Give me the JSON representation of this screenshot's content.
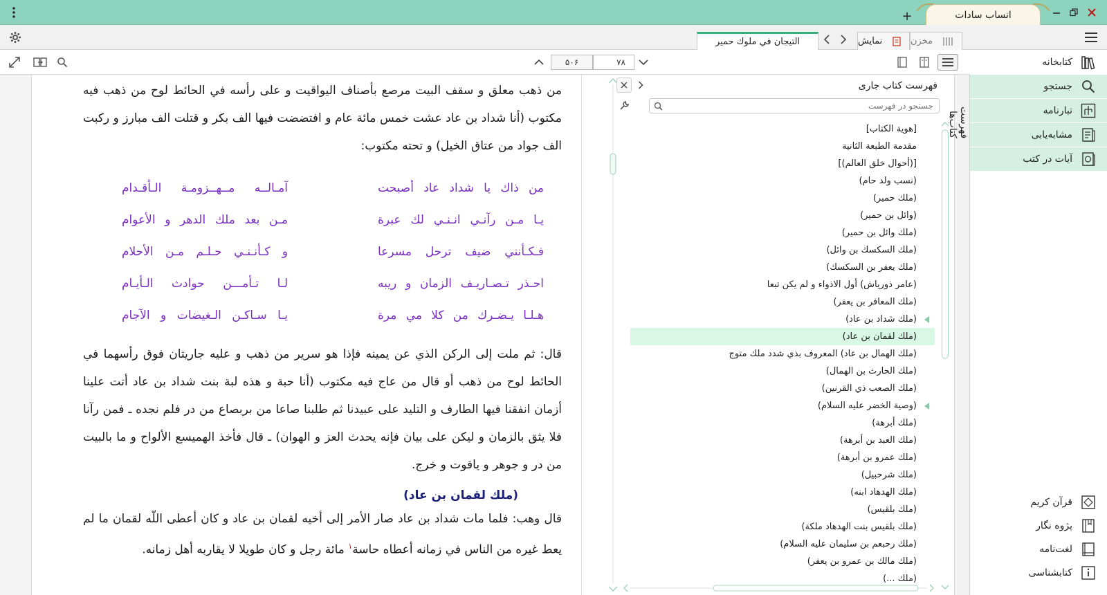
{
  "window": {
    "app_tab_label": "انساب سادات",
    "add_tab_label": "+"
  },
  "tabs": {
    "repository_label": "مخزن",
    "display_label": "نمایش",
    "book_tab_label": "التيجان في ملوك حمير"
  },
  "pager": {
    "current_page": "۷۸",
    "total_pages": "۵۰۶"
  },
  "toc": {
    "title": "فهرست کتاب جاری",
    "search_placeholder": "جستجو در فهرست",
    "items": [
      {
        "label": "[هوية الكتاب]",
        "expandable": false,
        "selected": false
      },
      {
        "label": "مقدمة الطبعة الثانية",
        "expandable": false,
        "selected": false
      },
      {
        "label": "[(أحوال خلق العالم)]",
        "expandable": false,
        "selected": false
      },
      {
        "label": "(نسب ولد حام)",
        "expandable": false,
        "selected": false
      },
      {
        "label": "(ملك حمير)",
        "expandable": false,
        "selected": false
      },
      {
        "label": "(وائل بن حمير)",
        "expandable": false,
        "selected": false
      },
      {
        "label": "(ملك وائل بن حمير)",
        "expandable": false,
        "selected": false
      },
      {
        "label": "(ملك السكسك بن وائل)",
        "expandable": false,
        "selected": false
      },
      {
        "label": "(ملك يعفر بن السكسك)",
        "expandable": false,
        "selected": false
      },
      {
        "label": "(عامر ذورياش) أول الاذواء و لم يكن تبعا",
        "expandable": false,
        "selected": false
      },
      {
        "label": "(ملك المعافر بن يعفر)",
        "expandable": false,
        "selected": false
      },
      {
        "label": "(ملك شداد بن عاد)",
        "expandable": true,
        "selected": false
      },
      {
        "label": "(ملك لقمان بن عاد)",
        "expandable": false,
        "selected": true
      },
      {
        "label": "(ملك الهمال بن عاد) المعروف بذي شدد ملك متوج",
        "expandable": false,
        "selected": false
      },
      {
        "label": "(ملك الحارث بن الهمال)",
        "expandable": false,
        "selected": false
      },
      {
        "label": "(ملك الصعب ذي القرنين)",
        "expandable": false,
        "selected": false
      },
      {
        "label": "(وصية الخضر عليه السلام)",
        "expandable": true,
        "selected": false
      },
      {
        "label": "(ملك أبرهة)",
        "expandable": false,
        "selected": false
      },
      {
        "label": "(ملك العبد بن أبرهة)",
        "expandable": false,
        "selected": false
      },
      {
        "label": "(ملك عمرو بن أبرهة)",
        "expandable": false,
        "selected": false
      },
      {
        "label": "(ملك شرحبيل)",
        "expandable": false,
        "selected": false
      },
      {
        "label": "(ملك الهدهاد ابنه)",
        "expandable": false,
        "selected": false
      },
      {
        "label": "(ملك بلقيس)",
        "expandable": false,
        "selected": false
      },
      {
        "label": "(ملك بلقيس بنت الهدهاد ملكة)",
        "expandable": false,
        "selected": false
      },
      {
        "label": "(ملك رحبعم بن سليمان عليه السلام)",
        "expandable": false,
        "selected": false
      },
      {
        "label": "(ملك مالك بن عمرو بن يعفر)",
        "expandable": false,
        "selected": false
      },
      {
        "label": "(ملك ...)",
        "expandable": false,
        "selected": false
      }
    ]
  },
  "side_tab_label": "فهرست کتاب‌ها",
  "sidebar": {
    "items": [
      {
        "label": "کتابخانه",
        "icon": "books-icon"
      },
      {
        "label": "جستجو",
        "icon": "search-icon"
      },
      {
        "label": "تبارنامه",
        "icon": "family-tree-icon"
      },
      {
        "label": "مشابه‌یابی",
        "icon": "similar-icon"
      },
      {
        "label": "آیات در کتب",
        "icon": "verses-icon"
      }
    ],
    "bottom_items": [
      {
        "label": "قرآن کریم",
        "icon": "quran-icon"
      },
      {
        "label": "پژوه نگار",
        "icon": "notebook-icon"
      },
      {
        "label": "لغت‌نامه",
        "icon": "dictionary-icon"
      },
      {
        "label": "کتابشناسی",
        "icon": "bibliography-icon"
      }
    ]
  },
  "content": {
    "para1": "من ذهب معلق و سقف البيت مرصع بأصناف اليواقيت و على رأسه في الحائط لوح من ذهب فيه مكتوب (أنا شداد بن عاد عشت خمس مائة عام و افتضضت فيها الف بكر و قتلت الف مبارز و ركبت الف جواد من عتاق الخيل) و تحته مكتوب:",
    "poem": [
      {
        "right": "من ذاك يا شداد عاد أصبحت",
        "left": "آمـالــه مــهــزومـة الـأقـدام"
      },
      {
        "right": "يـا مـن رآنـي انـنـي لك عبرة",
        "left": "مـن بعد ملك الدهر و الأعوام"
      },
      {
        "right": "فـكـأنني ضيف ترحل مسرعا",
        "left": "و كـأنـنـي حـلـم مـن الأحلام"
      },
      {
        "right": "احـذر تـصـاريـف الزمان و ريبه",
        "left": "لـا تـأمـــن حوادث الـأيـام"
      },
      {
        "right": "هـلـا يـضـرك من كلا مي مرة",
        "left": "يـا سـاكـن الـغيضات و الآجام"
      }
    ],
    "para2": "قال: ثم ملت إلى الركن الذي عن يمينه فإذا هو سرير من ذهب و عليه جاريتان فوق رأسهما في الحائط لوح من ذهب أو قال من عاج فيه مكتوب (أنا حبة و هذه لبة بنت شداد بن عاد أتت علينا أزمان انفقنا فيها الطارف و التليد على عبيدنا ثم طلبنا صاعا من بربصاع من در فلم نجده ـ فمن رآنا فلا يثق بالزمان و ليكن على بيان فإنه يحدث العز و الهوان) ـ قال فأخذ الهميسع الألواح و ما بالبيت من در و جوهر و ياقوت و خرج.",
    "heading": "(ملك لقمان بن عاد)",
    "para3_start": "قال وهب: فلما مات شداد بن عاد صار الأمر إلى أخيه لقمان بن عاد و كان أعطى اللّه لقمان ما لم يعط غيره من الناس في زمانه أعطاه حاسة",
    "footnote_ref": "۱",
    "para3_end": " مائة رجل و كان طويلا لا يقاربه أهل زمانه."
  },
  "colors": {
    "titlebar": "#8ed3bd",
    "accent_green": "#35b07b",
    "poem_purple": "#7a2ec2",
    "heading_blue": "#1a1f7a",
    "selected_row": "#d9f7e5"
  }
}
